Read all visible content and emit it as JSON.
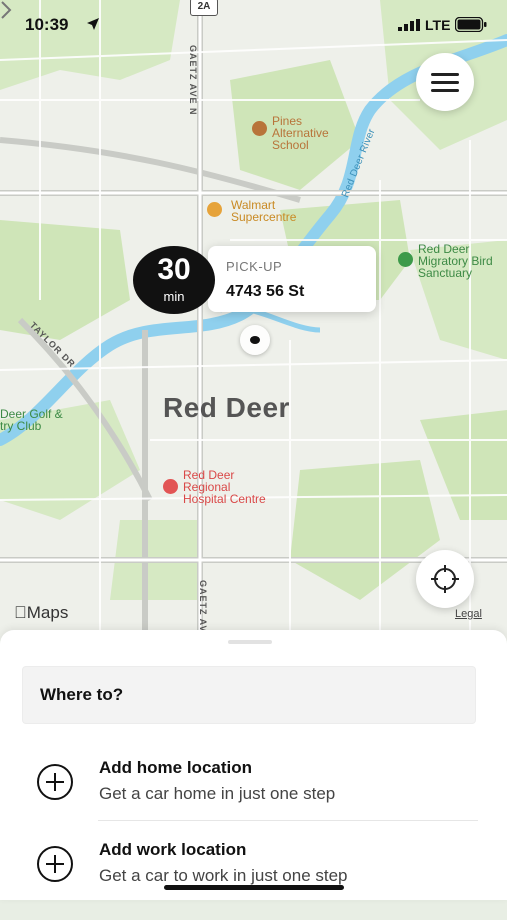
{
  "status_bar": {
    "time": "10:39",
    "network": "LTE"
  },
  "map": {
    "route_shield": "2A",
    "city_label": "Red Deer",
    "road_labels": [
      "GAETZ AVE N",
      "TAYLOR DR",
      "GAETZ AV"
    ],
    "river_label": "Red Deer River",
    "pois": [
      {
        "name": "Pines\nAlternative\nSchool",
        "color": "#b8743a"
      },
      {
        "name": "Walmart\nSupercentre",
        "color": "#e6a33a"
      },
      {
        "name": "Red Deer\nMigratory Bird\nSanctuary",
        "color": "#3d9a4a"
      },
      {
        "name": "Red Deer\nRegional\nHospital Centre",
        "color": "#e25555"
      },
      {
        "name": "Deer Golf &\ntry Club",
        "color": "#3d9a4a"
      }
    ],
    "attribution": "Maps",
    "legal": "Legal"
  },
  "eta": {
    "number": "30",
    "unit": "min"
  },
  "pickup": {
    "label": "PICK-UP",
    "address": "4743 56 St"
  },
  "sheet": {
    "search_placeholder": "Where to?",
    "shortcuts": [
      {
        "title": "Add home location",
        "subtitle": "Get a car home in just one step"
      },
      {
        "title": "Add work location",
        "subtitle": "Get a car to work in just one step"
      }
    ]
  },
  "colors": {
    "park": "#cfe5b8",
    "water": "#8fd0ee",
    "land": "#eef0ea",
    "accent": "#111111"
  }
}
